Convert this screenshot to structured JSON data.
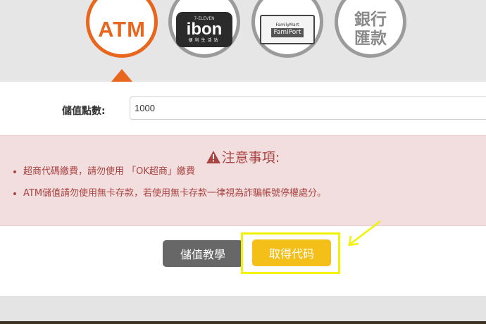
{
  "payment_methods": {
    "atm": {
      "label": "ATM",
      "selected": true
    },
    "ibon": {
      "brand_small": "7-ELEVEN",
      "label": "ibon",
      "sub": "便利生活站"
    },
    "famiport": {
      "brand_small": "FamilyMart",
      "label": "FamiPort"
    },
    "bank": {
      "line1": "銀行",
      "line2": "匯款"
    }
  },
  "form": {
    "amount_label": "儲值點數:",
    "amount_value": "1000"
  },
  "notice": {
    "title": "注意事項:",
    "items": [
      "超商代碼繳費，請勿使用 「OK超商」繳費",
      "ATM儲值請勿使用無卡存款，若使用無卡存款一律視為詐騙帳號停權處分。"
    ]
  },
  "buttons": {
    "tutorial": "儲值教學",
    "get_code": "取得代码"
  },
  "colors": {
    "accent_orange": "#e8661d",
    "get_code_yellow": "#f5bf1a",
    "tutorial_gray": "#676767",
    "notice_bg": "#f2dede",
    "notice_text": "#a94442",
    "highlight_yellow": "#f2f208"
  }
}
